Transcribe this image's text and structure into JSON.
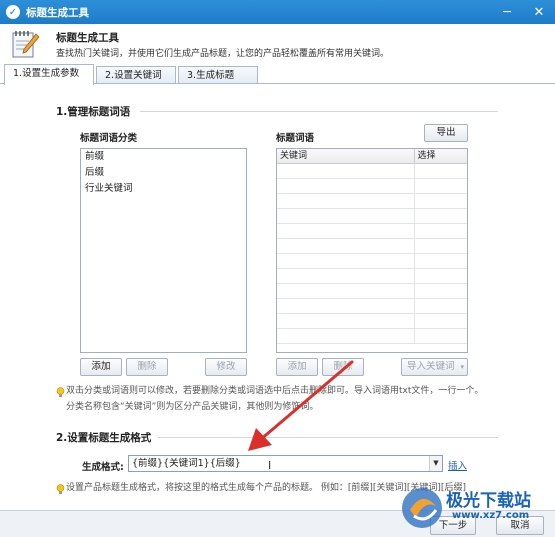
{
  "window": {
    "title": "标题生成工具"
  },
  "header": {
    "title": "标题生成工具",
    "description": "查找热门关键词，并使用它们生成产品标题，让您的产品轻松覆盖所有常用关键词。"
  },
  "tabs": [
    {
      "label": "1.设置生成参数",
      "active": true
    },
    {
      "label": "2.设置关键词",
      "active": false
    },
    {
      "label": "3.生成标题",
      "active": false
    }
  ],
  "section1": {
    "title": "1.管理标题词语",
    "category_label": "标题词语分类",
    "categories": [
      "前缀",
      "后缀",
      "行业关键词"
    ],
    "words_label": "标题词语",
    "export_button": "导出",
    "grid_columns": [
      "关键词",
      "选择"
    ],
    "left_buttons": {
      "add": "添加",
      "delete": "删除",
      "edit": "修改"
    },
    "right_buttons": {
      "add": "添加",
      "delete": "删除",
      "import": "导入关键词"
    },
    "tip_line1": "双击分类或词语则可以修改，若要删除分类或词语选中后点击删除即可。导入词语用txt文件，一行一个。",
    "tip_line2": "分类名称包含“关键词”则为区分产品关键词，其他则为修饰词。"
  },
  "section2": {
    "title": "2.设置标题生成格式",
    "format_label": "生成格式:",
    "format_value": "{前缀}{关键词1}{后缀}",
    "insert_link": "插入",
    "tip": "设置产品标题生成格式，将按这里的格式生成每个产品的标题。 例如：[前缀][关键词][关键词][后缀]"
  },
  "footer": {
    "next_button": "下一步",
    "cancel_button": "取消"
  },
  "watermark": {
    "brand": "极光下载站",
    "url": "www.xz7.com"
  },
  "colors": {
    "titlebar": "#1d7cc8",
    "arrow": "#d9302c",
    "link": "#1a5fb4"
  }
}
